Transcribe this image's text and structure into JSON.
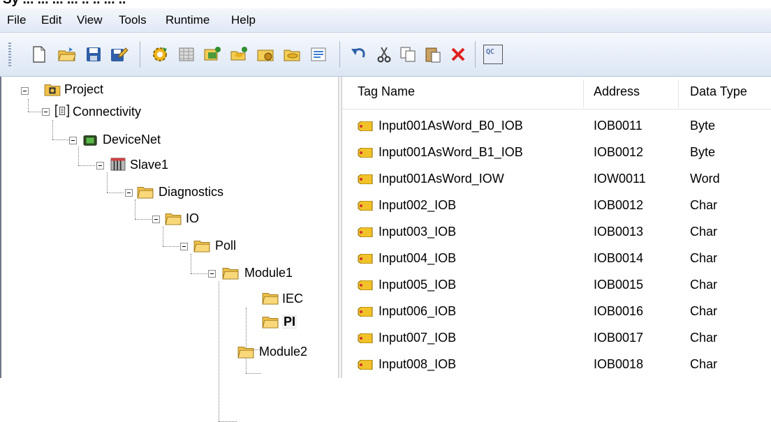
{
  "top_caption": "Sy ... ... ... ... .. .. ... ..",
  "menu": [
    "File",
    "Edit",
    "View",
    "Tools",
    "Runtime",
    "Help"
  ],
  "toolbar_icons": [
    "new-document-icon",
    "open-folder-icon",
    "save-icon",
    "save-all-icon",
    "gear-build-icon",
    "grid-icon",
    "add-device-icon",
    "add-folder-tag-icon",
    "device-config-icon",
    "folder-tag-icon",
    "properties-icon",
    "undo-icon",
    "cut-icon",
    "copy-icon",
    "paste-icon",
    "delete-icon",
    "quick-client-icon"
  ],
  "quick_client_label": "QC",
  "tree": {
    "project": "Project",
    "connectivity": "Connectivity",
    "devicenet": "DeviceNet",
    "slave1": "Slave1",
    "diagnostics": "Diagnostics",
    "io": "IO",
    "poll": "Poll",
    "module1": "Module1",
    "iec": "IEC",
    "pi": "PI",
    "module2": "Module2"
  },
  "columns": {
    "tag_name": "Tag Name",
    "address": "Address",
    "data_type": "Data Type"
  },
  "rows": [
    {
      "name": "Input001AsWord_B0_IOB",
      "address": "IOB0011",
      "type": "Byte"
    },
    {
      "name": "Input001AsWord_B1_IOB",
      "address": "IOB0012",
      "type": "Byte"
    },
    {
      "name": "Input001AsWord_IOW",
      "address": "IOW0011",
      "type": "Word"
    },
    {
      "name": "Input002_IOB",
      "address": "IOB0012",
      "type": "Char"
    },
    {
      "name": "Input003_IOB",
      "address": "IOB0013",
      "type": "Char"
    },
    {
      "name": "Input004_IOB",
      "address": "IOB0014",
      "type": "Char"
    },
    {
      "name": "Input005_IOB",
      "address": "IOB0015",
      "type": "Char"
    },
    {
      "name": "Input006_IOB",
      "address": "IOB0016",
      "type": "Char"
    },
    {
      "name": "Input007_IOB",
      "address": "IOB0017",
      "type": "Char"
    },
    {
      "name": "Input008_IOB",
      "address": "IOB0018",
      "type": "Char"
    }
  ]
}
